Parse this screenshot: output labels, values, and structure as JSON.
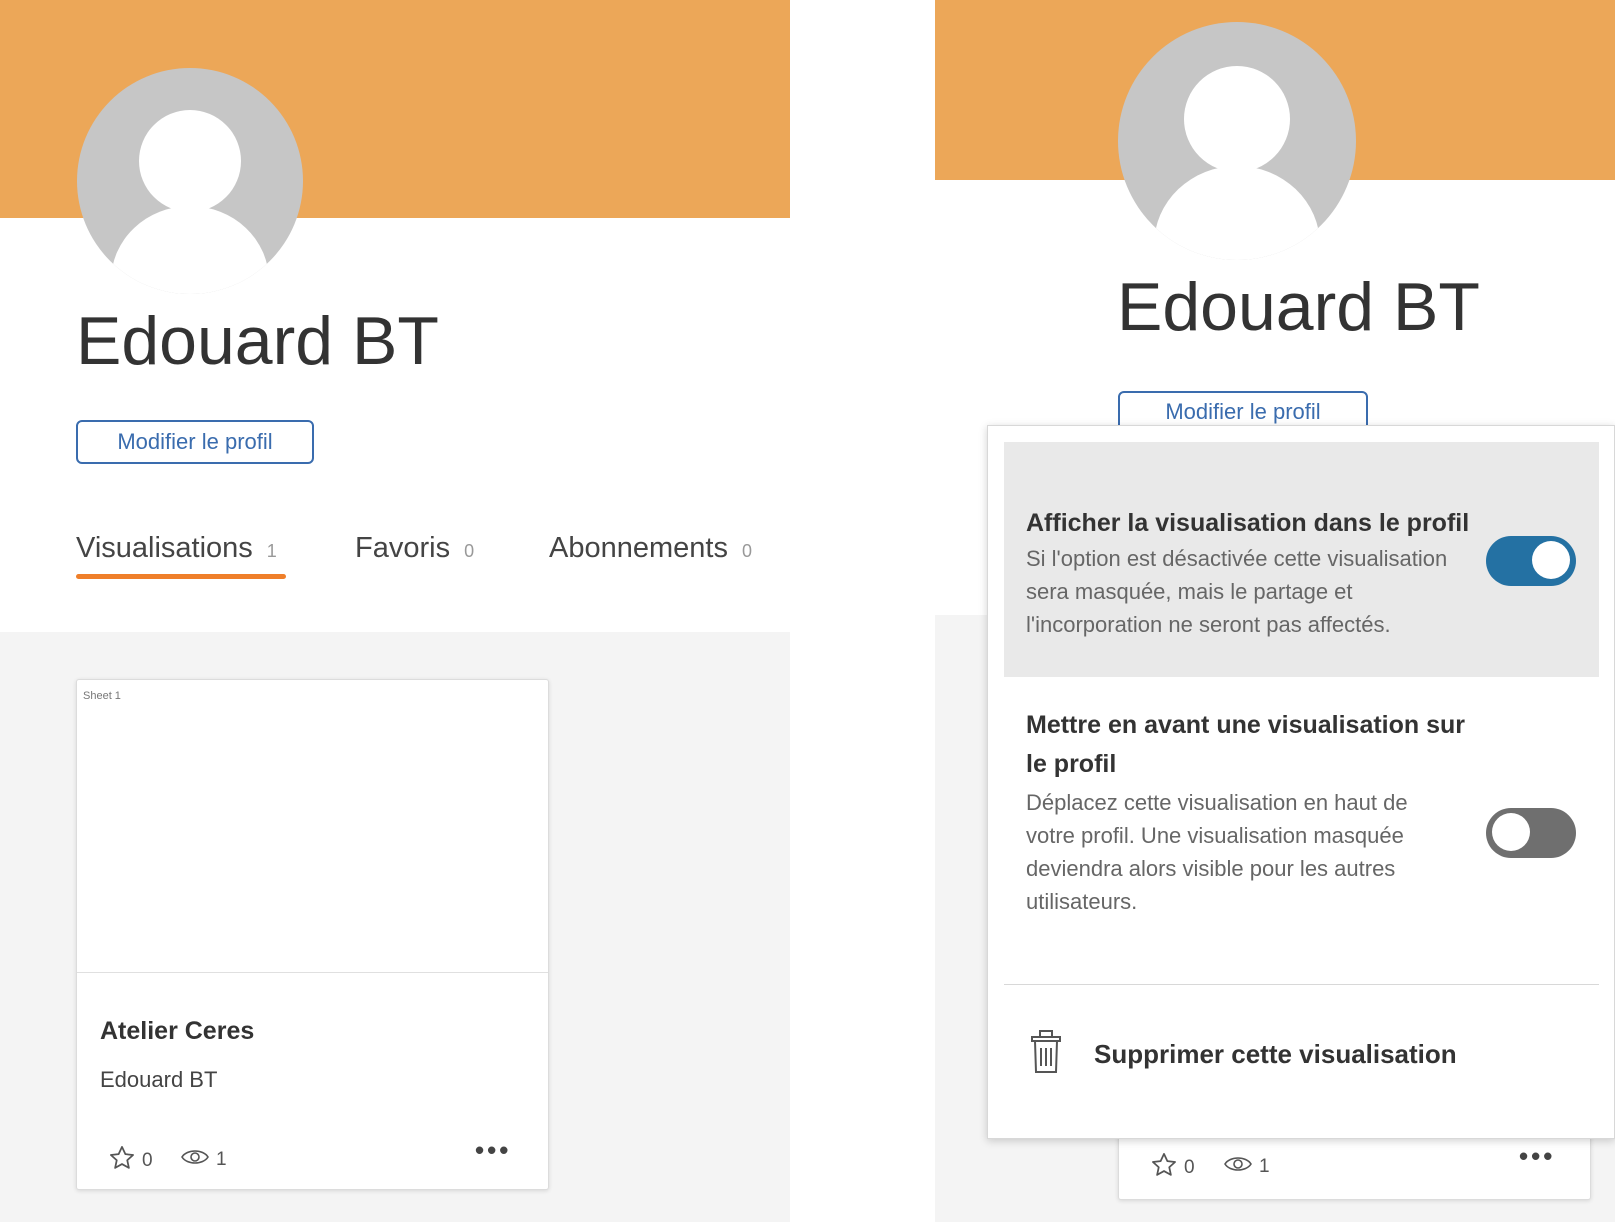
{
  "profile": {
    "name": "Edouard BT",
    "edit_button": "Modifier le profil"
  },
  "tabs": [
    {
      "label": "Visualisations",
      "count": "1",
      "active": true
    },
    {
      "label": "Favoris",
      "count": "0",
      "active": false
    },
    {
      "label": "Abonnements",
      "count": "0",
      "active": false
    }
  ],
  "card": {
    "sheet_label": "Sheet 1",
    "title": "Atelier Ceres",
    "author": "Edouard BT",
    "favorites": "0",
    "views": "1",
    "more_label": "•••"
  },
  "menu": {
    "option_show": {
      "title": "Afficher la visualisation dans le profil",
      "desc_lines": [
        "Si l'option est désactivée cette visualisation",
        "sera masquée, mais le partage et",
        "l'incorporation ne seront pas affectés."
      ],
      "enabled": true
    },
    "option_feature": {
      "title_lines": [
        "Mettre en avant une visualisation sur",
        "le profil"
      ],
      "desc_lines": [
        "Déplacez cette visualisation en haut de",
        "votre profil. Une visualisation masquée",
        "deviendra alors visible pour les autres",
        "utilisateurs."
      ],
      "enabled": false
    },
    "delete_label": "Supprimer cette visualisation"
  },
  "colors": {
    "banner": "#eca758",
    "accent_tab": "#ef7f2a",
    "link_blue": "#3a6cae",
    "toggle_on": "#2471a3",
    "toggle_off": "#6f6f6f"
  },
  "icons": [
    "user-avatar-icon",
    "star-icon",
    "eye-icon",
    "more-icon",
    "trash-icon"
  ]
}
